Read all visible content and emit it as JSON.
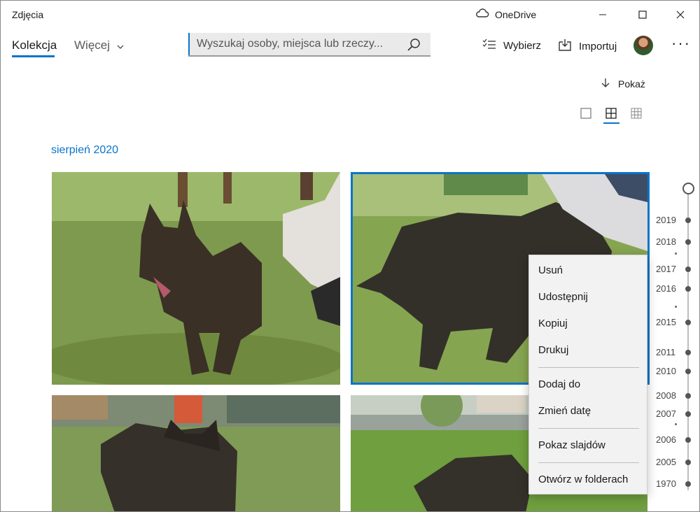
{
  "window": {
    "title": "Zdjęcia",
    "onedrive_label": "OneDrive"
  },
  "nav": {
    "tab_collection": "Kolekcja",
    "tab_more": "Więcej"
  },
  "search": {
    "placeholder": "Wyszukaj osoby, miejsca lub rzeczy..."
  },
  "commands": {
    "select": "Wybierz",
    "import": "Importuj"
  },
  "sort": {
    "label": "Pokaż"
  },
  "gallery": {
    "month_label": "sierpień 2020"
  },
  "timeline": {
    "years": [
      "2019",
      "2018",
      "2017",
      "2016",
      "2015",
      "2011",
      "2010",
      "2008",
      "2007",
      "2006",
      "2005",
      "1970"
    ]
  },
  "context_menu": {
    "items": [
      "Usuń",
      "Udostępnij",
      "Kopiuj",
      "Drukuj",
      "Dodaj do",
      "Zmień datę",
      "Pokaz slajdów",
      "Otwórz w folderach"
    ]
  },
  "colors": {
    "accent": "#0a74c9"
  }
}
